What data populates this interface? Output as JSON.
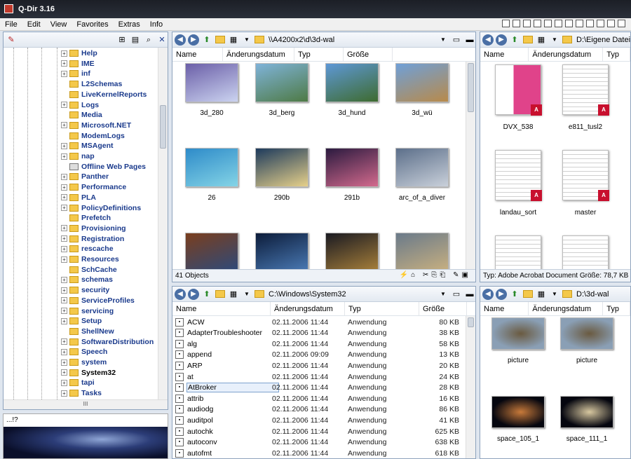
{
  "window": {
    "title": "Q-Dir 3.16"
  },
  "menu": [
    "File",
    "Edit",
    "View",
    "Favorites",
    "Extras",
    "Info"
  ],
  "tree": {
    "items": [
      {
        "label": "Help",
        "exp": "+"
      },
      {
        "label": "IME",
        "exp": "+"
      },
      {
        "label": "inf",
        "exp": "+"
      },
      {
        "label": "L2Schemas",
        "exp": ""
      },
      {
        "label": "LiveKernelReports",
        "exp": ""
      },
      {
        "label": "Logs",
        "exp": "+"
      },
      {
        "label": "Media",
        "exp": ""
      },
      {
        "label": "Microsoft.NET",
        "exp": "+"
      },
      {
        "label": "ModemLogs",
        "exp": ""
      },
      {
        "label": "MSAgent",
        "exp": "+"
      },
      {
        "label": "nap",
        "exp": "+"
      },
      {
        "label": "Offline Web Pages",
        "exp": "",
        "web": true
      },
      {
        "label": "Panther",
        "exp": "+"
      },
      {
        "label": "Performance",
        "exp": "+"
      },
      {
        "label": "PLA",
        "exp": "+"
      },
      {
        "label": "PolicyDefinitions",
        "exp": "+"
      },
      {
        "label": "Prefetch",
        "exp": ""
      },
      {
        "label": "Provisioning",
        "exp": "+"
      },
      {
        "label": "Registration",
        "exp": "+"
      },
      {
        "label": "rescache",
        "exp": "+"
      },
      {
        "label": "Resources",
        "exp": "+"
      },
      {
        "label": "SchCache",
        "exp": ""
      },
      {
        "label": "schemas",
        "exp": "+"
      },
      {
        "label": "security",
        "exp": "+"
      },
      {
        "label": "ServiceProfiles",
        "exp": "+"
      },
      {
        "label": "servicing",
        "exp": "+"
      },
      {
        "label": "Setup",
        "exp": "+"
      },
      {
        "label": "ShellNew",
        "exp": ""
      },
      {
        "label": "SoftwareDistribution",
        "exp": "+"
      },
      {
        "label": "Speech",
        "exp": "+"
      },
      {
        "label": "system",
        "exp": "+"
      },
      {
        "label": "System32",
        "exp": "+",
        "sel": true
      },
      {
        "label": "tapi",
        "exp": "+"
      },
      {
        "label": "Tasks",
        "exp": "+"
      }
    ],
    "hscroll_label": "III"
  },
  "preview": {
    "label": "...!?"
  },
  "pane1": {
    "path": "\\\\A4200x2\\d\\3d-wal",
    "columns": [
      "Name",
      "Änderungsdatum",
      "Typ",
      "Größe"
    ],
    "thumbs": [
      {
        "name": "3d_280",
        "colors": [
          "#6b5fa8",
          "#cbd3f0"
        ]
      },
      {
        "name": "3d_berg",
        "colors": [
          "#7fb3d9",
          "#4e7a45"
        ]
      },
      {
        "name": "3d_hund",
        "colors": [
          "#5e98d6",
          "#3e6b2f"
        ]
      },
      {
        "name": "3d_wü",
        "colors": [
          "#6fa0d8",
          "#b88a4a"
        ]
      },
      {
        "name": "26",
        "colors": [
          "#2e8bc9",
          "#84d4e6"
        ]
      },
      {
        "name": "290b",
        "colors": [
          "#1d3a5c",
          "#e6d08a"
        ]
      },
      {
        "name": "291b",
        "colors": [
          "#2b1a3f",
          "#d36a8d"
        ]
      },
      {
        "name": "arc_of_a_diver",
        "colors": [
          "#5c6f8a",
          "#c9d0da"
        ]
      },
      {
        "name": "",
        "colors": [
          "#7a3e1e",
          "#2d4a7a"
        ]
      },
      {
        "name": "",
        "colors": [
          "#0c1c3a",
          "#4a7ab5"
        ]
      },
      {
        "name": "",
        "colors": [
          "#1a1a22",
          "#a8803a"
        ]
      },
      {
        "name": "",
        "colors": [
          "#6a7a8a",
          "#c8b080"
        ]
      }
    ],
    "status": "41 Objects"
  },
  "pane2": {
    "path": "D:\\Eigene Dateie",
    "columns": [
      "Name",
      "Änderungsdatum",
      "Typ"
    ],
    "docs": [
      {
        "name": "DVX_538",
        "pink": true
      },
      {
        "name": "e811_tusl2",
        "pink": false
      },
      {
        "name": "landau_sort",
        "pink": false
      },
      {
        "name": "master",
        "pink": false
      },
      {
        "name": "",
        "pink": false
      },
      {
        "name": "",
        "pink": false
      }
    ],
    "status": "Typ: Adobe Acrobat Document Größe: 78,7 KB"
  },
  "pane3": {
    "path": "C:\\Windows\\System32",
    "columns": [
      "Name",
      "Änderungsdatum",
      "Typ",
      "Größe"
    ],
    "rows": [
      {
        "name": "ACW",
        "date": "02.11.2006 11:44",
        "type": "Anwendung",
        "size": "80 KB"
      },
      {
        "name": "AdapterTroubleshooter",
        "date": "02.11.2006 11:44",
        "type": "Anwendung",
        "size": "38 KB"
      },
      {
        "name": "alg",
        "date": "02.11.2006 11:44",
        "type": "Anwendung",
        "size": "58 KB"
      },
      {
        "name": "append",
        "date": "02.11.2006 09:09",
        "type": "Anwendung",
        "size": "13 KB"
      },
      {
        "name": "ARP",
        "date": "02.11.2006 11:44",
        "type": "Anwendung",
        "size": "20 KB"
      },
      {
        "name": "at",
        "date": "02.11.2006 11:44",
        "type": "Anwendung",
        "size": "24 KB"
      },
      {
        "name": "AtBroker",
        "date": "02.11.2006 11:44",
        "type": "Anwendung",
        "size": "28 KB",
        "hl": true
      },
      {
        "name": "attrib",
        "date": "02.11.2006 11:44",
        "type": "Anwendung",
        "size": "16 KB"
      },
      {
        "name": "audiodg",
        "date": "02.11.2006 11:44",
        "type": "Anwendung",
        "size": "86 KB"
      },
      {
        "name": "auditpol",
        "date": "02.11.2006 11:44",
        "type": "Anwendung",
        "size": "41 KB"
      },
      {
        "name": "autochk",
        "date": "02.11.2006 11:44",
        "type": "Anwendung",
        "size": "625 KB"
      },
      {
        "name": "autoconv",
        "date": "02.11.2006 11:44",
        "type": "Anwendung",
        "size": "638 KB"
      },
      {
        "name": "autofmt",
        "date": "02.11.2006 11:44",
        "type": "Anwendung",
        "size": "618 KB"
      }
    ]
  },
  "pane4": {
    "path": "D:\\3d-wal",
    "columns": [
      "Name",
      "Änderungsdatum",
      "Typ"
    ],
    "thumbs": [
      {
        "name": "picture",
        "colors": [
          "#8a9fb5",
          "#6a5a40"
        ]
      },
      {
        "name": "picture",
        "colors": [
          "#8a9fb5",
          "#6a5a40"
        ]
      },
      {
        "name": "space_105_1",
        "colors": [
          "#05060f",
          "#c87a3a"
        ]
      },
      {
        "name": "space_111_1",
        "colors": [
          "#05060f",
          "#d8c8a0"
        ]
      }
    ]
  }
}
